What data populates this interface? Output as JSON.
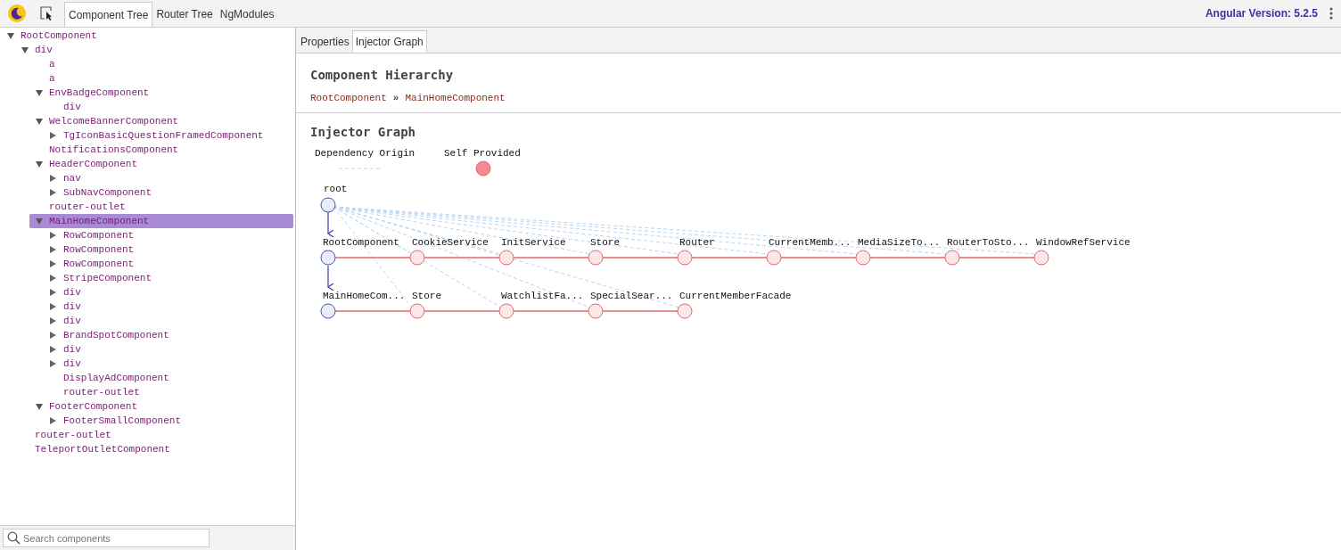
{
  "toolbar": {
    "tabs": [
      {
        "label": "Component Tree",
        "selected": true
      },
      {
        "label": "Router Tree",
        "selected": false
      },
      {
        "label": "NgModules",
        "selected": false
      }
    ],
    "version": "Angular Version: 5.2.5"
  },
  "tree": [
    {
      "label": "RootComponent",
      "expanded": true,
      "selected": false,
      "children": [
        {
          "label": "div",
          "expanded": true,
          "selected": false,
          "children": [
            {
              "label": "a",
              "selected": false
            },
            {
              "label": "a",
              "selected": false
            },
            {
              "label": "EnvBadgeComponent",
              "expanded": true,
              "selected": false,
              "children": [
                {
                  "label": "div",
                  "selected": false
                }
              ]
            },
            {
              "label": "WelcomeBannerComponent",
              "expanded": true,
              "selected": false,
              "children": [
                {
                  "label": "TgIconBasicQuestionFramedComponent",
                  "expanded": false,
                  "selected": false
                }
              ]
            },
            {
              "label": "NotificationsComponent",
              "selected": false
            },
            {
              "label": "HeaderComponent",
              "expanded": true,
              "selected": false,
              "children": [
                {
                  "label": "nav",
                  "expanded": false,
                  "selected": false
                },
                {
                  "label": "SubNavComponent",
                  "expanded": false,
                  "selected": false
                }
              ]
            },
            {
              "label": "router-outlet",
              "selected": false
            },
            {
              "label": "MainHomeComponent",
              "expanded": true,
              "selected": true,
              "children": [
                {
                  "label": "RowComponent",
                  "expanded": false,
                  "selected": false
                },
                {
                  "label": "RowComponent",
                  "expanded": false,
                  "selected": false
                },
                {
                  "label": "RowComponent",
                  "expanded": false,
                  "selected": false
                },
                {
                  "label": "StripeComponent",
                  "expanded": false,
                  "selected": false
                },
                {
                  "label": "div",
                  "expanded": false,
                  "selected": false
                },
                {
                  "label": "div",
                  "expanded": false,
                  "selected": false
                },
                {
                  "label": "div",
                  "expanded": false,
                  "selected": false
                },
                {
                  "label": "BrandSpotComponent",
                  "expanded": false,
                  "selected": false
                },
                {
                  "label": "div",
                  "expanded": false,
                  "selected": false
                },
                {
                  "label": "div",
                  "expanded": false,
                  "selected": false
                },
                {
                  "label": "DisplayAdComponent",
                  "selected": false
                },
                {
                  "label": "router-outlet",
                  "selected": false
                }
              ]
            },
            {
              "label": "FooterComponent",
              "expanded": true,
              "selected": false,
              "children": [
                {
                  "label": "FooterSmallComponent",
                  "expanded": false,
                  "selected": false
                }
              ]
            }
          ]
        },
        {
          "label": "router-outlet",
          "selected": false
        },
        {
          "label": "TeleportOutletComponent",
          "selected": false
        }
      ]
    }
  ],
  "search": {
    "placeholder": "Search components"
  },
  "detail_tabs": [
    {
      "label": "Properties",
      "selected": false
    },
    {
      "label": "Injector Graph",
      "selected": true
    }
  ],
  "hierarchy": {
    "title": "Component Hierarchy",
    "path": [
      "RootComponent",
      "MainHomeComponent"
    ],
    "separator": "»"
  },
  "graph": {
    "title": "Injector Graph",
    "legend": {
      "dependency_origin": "Dependency Origin",
      "self_provided": "Self Provided"
    },
    "root": "root",
    "rows": [
      {
        "nodes": [
          {
            "label": "RootComponent",
            "kind": "component"
          },
          {
            "label": "CookieService",
            "kind": "service"
          },
          {
            "label": "InitService",
            "kind": "service"
          },
          {
            "label": "Store",
            "kind": "service"
          },
          {
            "label": "Router",
            "kind": "service"
          },
          {
            "label": "CurrentMemb...",
            "kind": "service"
          },
          {
            "label": "MediaSizeTo...",
            "kind": "service"
          },
          {
            "label": "RouterToSto...",
            "kind": "service"
          },
          {
            "label": "WindowRefService",
            "kind": "service"
          }
        ]
      },
      {
        "nodes": [
          {
            "label": "MainHomeCom...",
            "kind": "component"
          },
          {
            "label": "Store",
            "kind": "service"
          },
          {
            "label": "WatchlistFa...",
            "kind": "service"
          },
          {
            "label": "SpecialSear...",
            "kind": "service"
          },
          {
            "label": "CurrentMemberFacade",
            "kind": "service"
          }
        ]
      }
    ]
  }
}
